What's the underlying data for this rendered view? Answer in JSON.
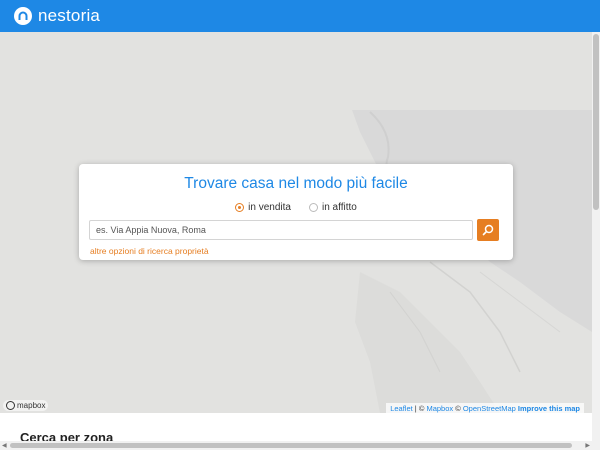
{
  "header": {
    "logo_text": "nestoria",
    "logo_icon": "house-arch-icon",
    "color": "#1e88e5"
  },
  "search_card": {
    "title": "Trovare casa nel modo più facile",
    "options": [
      {
        "label": "in vendita",
        "checked": true
      },
      {
        "label": "in affitto",
        "checked": false
      }
    ],
    "input": {
      "value": "",
      "placeholder": "es. Via Appia Nuova, Roma"
    },
    "search_button_icon": "search-icon",
    "more_options": "altre opzioni di ricerca proprietà",
    "accent": "#e67e22",
    "title_color": "#1e88e5"
  },
  "map": {
    "mapbox_logo": "mapbox",
    "attribution": {
      "leaflet": "Leaflet",
      "sep1": " | © ",
      "mapbox": "Mapbox",
      "sep2": " © ",
      "osm": "OpenStreetMap",
      "improve": "Improve this map"
    }
  },
  "section": {
    "title": "Cerca per zona"
  }
}
